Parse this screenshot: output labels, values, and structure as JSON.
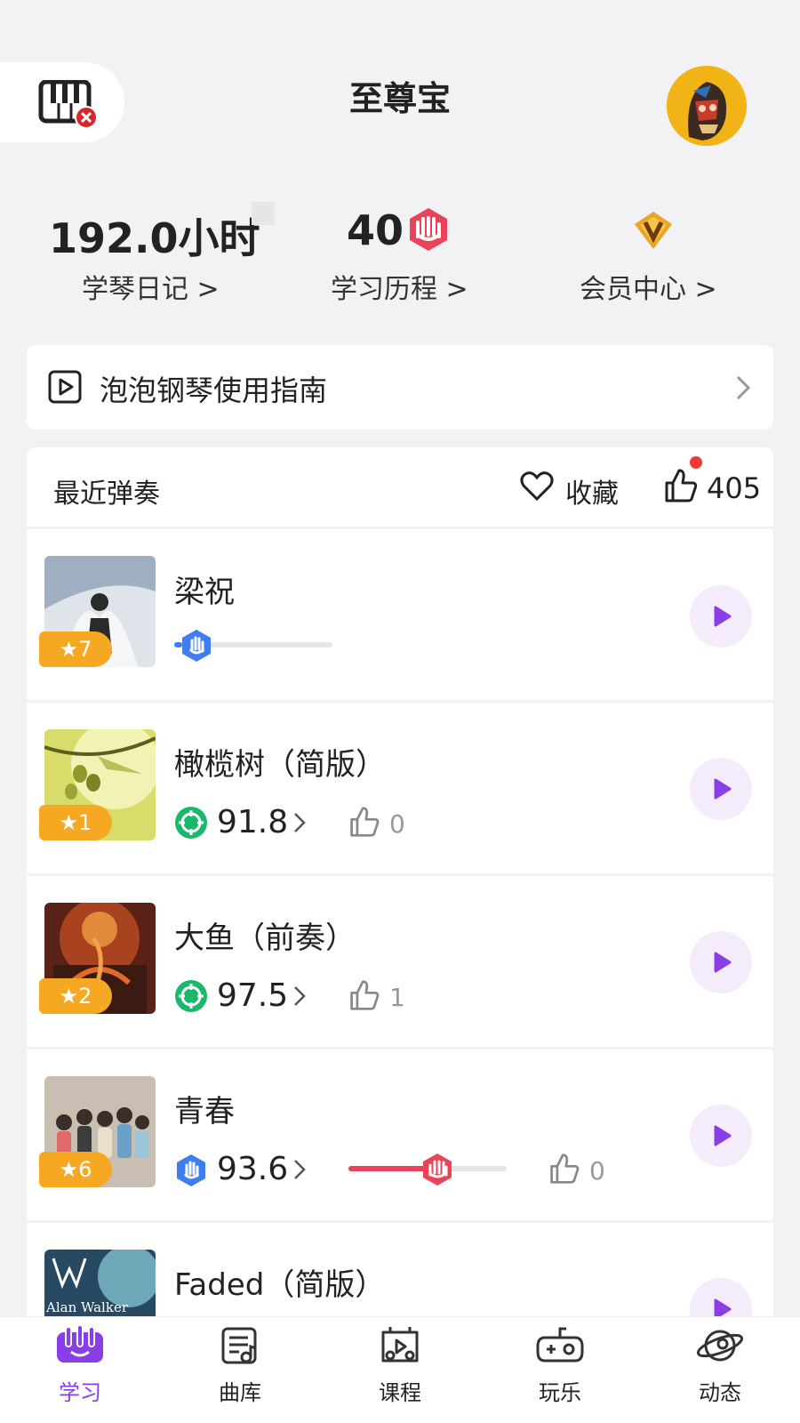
{
  "header": {
    "title": "至尊宝"
  },
  "stats": [
    {
      "value": "192.0小时",
      "label": "学琴日记 >"
    },
    {
      "value": "40",
      "label": "学习历程 >"
    },
    {
      "value": "",
      "label": "会员中心 >"
    }
  ],
  "guide": {
    "label": "泡泡钢琴使用指南"
  },
  "recent": {
    "title": "最近弹奏",
    "favorites_label": "收藏",
    "likes_count": "405"
  },
  "songs": [
    {
      "title": "梁祝",
      "stars": "★7",
      "progress": 0.05,
      "thumb_color": "#dfe5ea"
    },
    {
      "title": "橄榄树（简版）",
      "stars": "★1",
      "score": "91.8",
      "likes": "0"
    },
    {
      "title": "大鱼（前奏）",
      "stars": "★2",
      "score": "97.5",
      "likes": "1"
    },
    {
      "title": "青春",
      "stars": "★6",
      "score": "93.6",
      "progress": 0.57,
      "likes": "0"
    },
    {
      "title": "Faded（简版）",
      "stars": "",
      "thumb_text": "Alan Walker"
    }
  ],
  "nav": [
    {
      "label": "学习",
      "icon": "learn-icon",
      "active": true
    },
    {
      "label": "曲库",
      "icon": "library-icon"
    },
    {
      "label": "课程",
      "icon": "course-icon"
    },
    {
      "label": "玩乐",
      "icon": "gamepad-icon"
    },
    {
      "label": "动态",
      "icon": "planet-icon"
    }
  ],
  "colors": {
    "accent": "#8a3ee6",
    "badge_orange": "#f7a823",
    "score_green": "#19b86b",
    "hand_blue": "#3f7ef2",
    "hand_red": "#e84359"
  }
}
